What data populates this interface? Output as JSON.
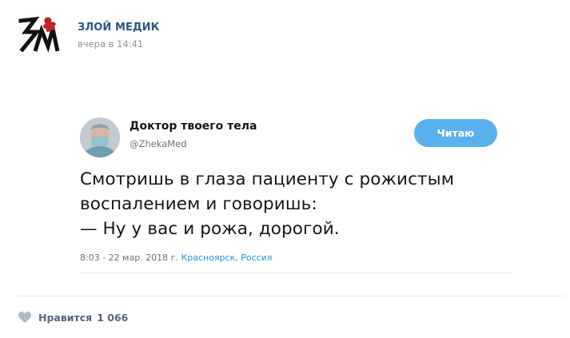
{
  "post": {
    "author": "ЗЛОЙ МЕДИК",
    "time": "вчера в 14:41",
    "logo_text": "ЗМ"
  },
  "tweet": {
    "display_name": "Доктор твоего тела",
    "handle": "@ZhekaMed",
    "follow_label": "Читаю",
    "text": "Смотришь в глаза пациенту с рожистым\nвоспалением и говоришь:\n— Ну у вас и рожа, дорогой.",
    "meta_time": "8:03 - 22 мар. 2018 г. ",
    "meta_location": "Красноярск, Россия"
  },
  "likes": {
    "label": "Нравится",
    "count": "1 066"
  },
  "colors": {
    "link": "#2a5885",
    "follow_button": "#5ab0ec",
    "logo_accent": "#c0242c",
    "twitter_link": "#1b95e0"
  }
}
